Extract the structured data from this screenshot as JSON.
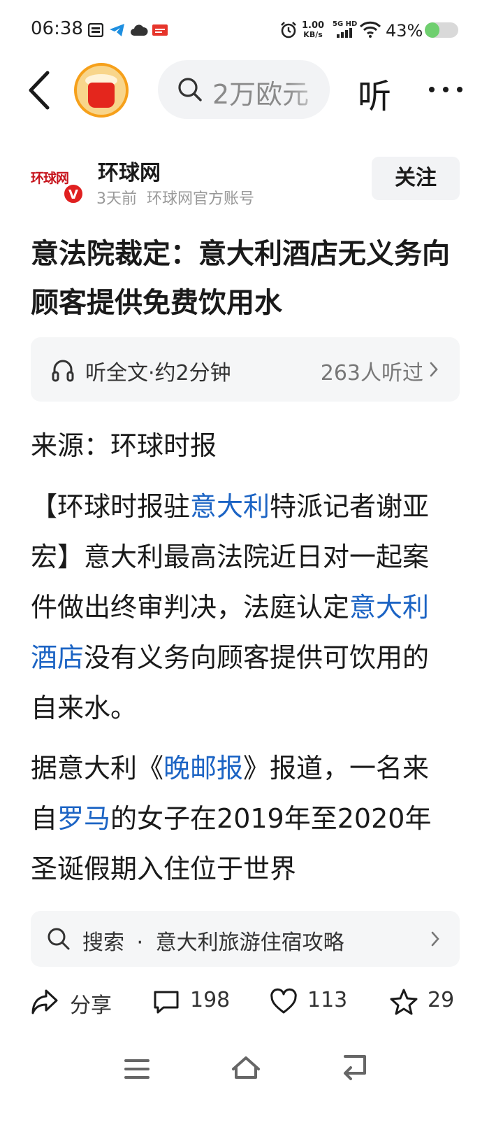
{
  "status_bar": {
    "time": "06:38",
    "net_speed_value": "1.00",
    "net_speed_unit": "KB/s",
    "network_type": "5G HD",
    "battery_percent": "43%",
    "battery_level": 0.43,
    "battery_color": "#6fcf6f",
    "icons": [
      "sim-card-icon",
      "telegram-icon",
      "cloud-icon",
      "toutiao-icon",
      "alarm-icon",
      "signal-icon",
      "wifi-icon",
      "battery-icon"
    ]
  },
  "top_nav": {
    "search_placeholder": "2万欧元",
    "listen_label": "听",
    "icons": [
      "back-arrow-icon",
      "more-dots-icon"
    ]
  },
  "author": {
    "logo_text": "环球网",
    "verified_mark": "V",
    "name": "环球网",
    "time_ago": "3天前",
    "account_type": "环球网官方账号",
    "follow_label": "关注"
  },
  "article": {
    "title": "意法院裁定：意大利酒店无义务向顾客提供免费饮用水",
    "listen": {
      "label": "听全文·约2分钟",
      "count": "263人听过"
    },
    "source": "来源：环球时报",
    "paragraphs": [
      [
        {
          "text": "【环球时报驻",
          "link": false
        },
        {
          "text": "意大利",
          "link": true
        },
        {
          "text": "特派记者谢亚宏】意大利最高法院近日对一起案件做出终审判决，法庭认定",
          "link": false
        },
        {
          "text": "意大利酒店",
          "link": true
        },
        {
          "text": "没有义务向顾客提供可饮用的自来水。",
          "link": false
        }
      ],
      [
        {
          "text": "据意大利《",
          "link": false
        },
        {
          "text": "晚邮报",
          "link": true
        },
        {
          "text": "》报道，一名来自",
          "link": false
        },
        {
          "text": "罗马",
          "link": true
        },
        {
          "text": "的女子在2019年至2020年圣诞假期入住位于世界",
          "link": false
        }
      ]
    ],
    "link_color": "#1c64c4"
  },
  "related_search": {
    "prefix": "搜索",
    "separator": "·",
    "query": "意大利旅游住宿攻略"
  },
  "actions": {
    "share_label": "分享",
    "comments": "198",
    "likes": "113",
    "favorites": "29"
  }
}
